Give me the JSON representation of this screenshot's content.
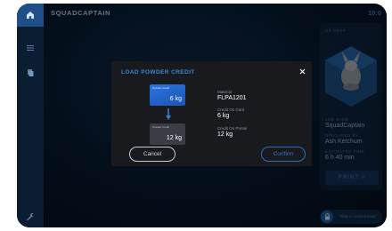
{
  "topbar": {
    "title": "SQUADCAPTAIN",
    "time": "10:0"
  },
  "right_panel": {
    "up_next_label": "UP NEXT",
    "job_name_label": "JOB NAME",
    "job_name": "SquadCaptain",
    "uploaded_by_label": "UPLOADED BY",
    "uploaded_by": "Ash Ketchum",
    "estimated_time_label": "ESTIMATED TIME",
    "estimated_time": "6 h 40 min",
    "print_label": "PRINT >"
  },
  "unlock": {
    "label": "Slide to Unlock Door"
  },
  "modal": {
    "title": "LOAD POWDER CREDIT",
    "card_top": {
      "small_text": "Powder Credit",
      "amount": "6 kg"
    },
    "card_bottom": {
      "small_text": "Powder Credit",
      "amount": "12 kg"
    },
    "material_label": "Material",
    "material": "FLPA1201",
    "credit_card_label": "Credit On Card",
    "credit_card": "6 kg",
    "credit_printer_label": "Credit On Printer",
    "credit_printer": "12 kg",
    "cancel_label": "Cancel",
    "confirm_label": "Confirm"
  },
  "colors": {
    "accent": "#2f79cc",
    "background": "#071a30",
    "modal": "#181a1e"
  }
}
